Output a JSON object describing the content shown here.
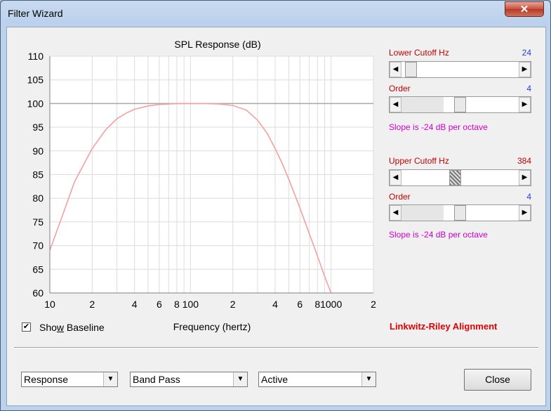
{
  "window": {
    "title": "Filter Wizard",
    "close_glyph": "✕"
  },
  "chart_data": {
    "type": "line",
    "title": "SPL Response (dB)",
    "xlabel": "Frequency (hertz)",
    "ylabel": "",
    "x_scale": "log",
    "xlim": [
      10,
      2000
    ],
    "ylim": [
      60,
      110
    ],
    "y_ticks": [
      110,
      105,
      100,
      95,
      90,
      85,
      80,
      75,
      70,
      65,
      60
    ],
    "x_tick_labels": [
      {
        "x": 10,
        "label": "10"
      },
      {
        "x": 20,
        "label": "2"
      },
      {
        "x": 40,
        "label": "4"
      },
      {
        "x": 60,
        "label": "6"
      },
      {
        "x": 80,
        "label": "8"
      },
      {
        "x": 100,
        "label": "100"
      },
      {
        "x": 200,
        "label": "2"
      },
      {
        "x": 400,
        "label": "4"
      },
      {
        "x": 600,
        "label": "6"
      },
      {
        "x": 800,
        "label": "8"
      },
      {
        "x": 1000,
        "label": "1000"
      },
      {
        "x": 2000,
        "label": "2"
      }
    ],
    "baseline_db": 100,
    "series": [
      {
        "color": "#f4a0a0",
        "x": [
          10,
          12,
          15,
          20,
          25,
          30,
          35,
          40,
          50,
          60,
          70,
          80,
          100,
          130,
          160,
          200,
          250,
          300,
          350,
          400,
          450,
          500,
          600,
          700,
          800,
          900,
          1000
        ],
        "y": [
          69,
          75.5,
          83.5,
          90.5,
          94.5,
          96.8,
          98.0,
          98.8,
          99.5,
          99.8,
          99.9,
          100,
          100,
          100,
          99.9,
          99.6,
          98.6,
          96.5,
          93.8,
          90.5,
          87.3,
          84.0,
          78.0,
          72.5,
          67.8,
          63.5,
          60
        ]
      }
    ]
  },
  "controls": {
    "lower_cutoff_label": "Lower Cutoff  Hz",
    "lower_cutoff_value": "24",
    "lower_cutoff_pos": 0.03,
    "lower_order_label": "Order",
    "lower_order_value": "4",
    "lower_order_pos": 0.5,
    "lower_slope": "Slope is -24 dB per octave",
    "upper_cutoff_label": "Upper Cutoff  Hz",
    "upper_cutoff_value": "384",
    "upper_cutoff_pos": 0.45,
    "upper_order_label": "Order",
    "upper_order_value": "4",
    "upper_order_pos": 0.5,
    "upper_slope": "Slope is -24 dB per octave",
    "alignment": "Linkwitz-Riley Alignment",
    "left_arrow": "◀",
    "right_arrow": "▶"
  },
  "baseline": {
    "checked": true,
    "check_glyph": "✔",
    "label_pre": "Sho",
    "label_u": "w",
    "label_post": " Baseline"
  },
  "footer": {
    "combo1": "Response",
    "combo2": "Band Pass",
    "combo3": "Active",
    "dd_glyph": "▼",
    "close_label": "Close"
  }
}
